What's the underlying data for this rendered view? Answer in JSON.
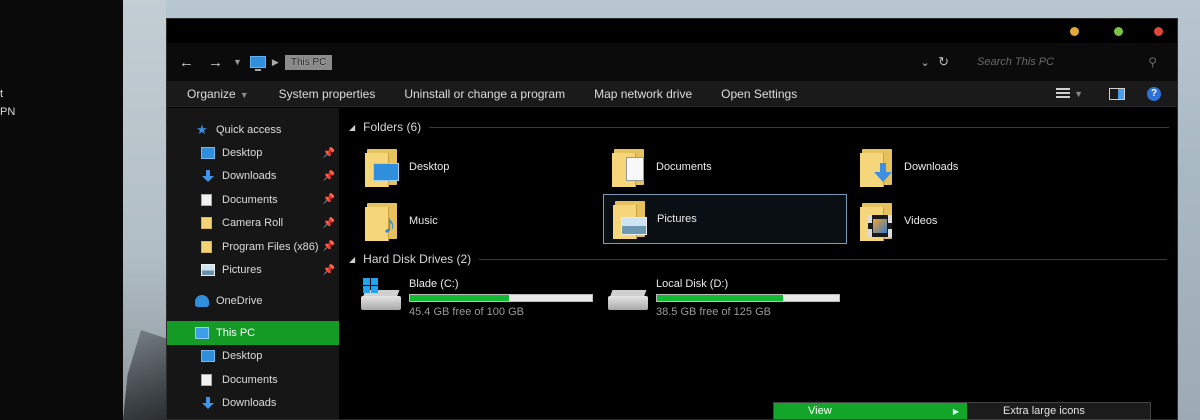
{
  "left_panel": {
    "line1": "t",
    "line2": "PN"
  },
  "address_bar": {
    "back_icon": "back-arrow-icon",
    "forward_icon": "forward-arrow-icon",
    "crumb": "This PC",
    "search_placeholder": "Search This PC"
  },
  "toolbar": {
    "items": [
      "Organize",
      "System properties",
      "Uninstall or change a program",
      "Map network drive",
      "Open Settings"
    ]
  },
  "nav": {
    "quick_access": "Quick access",
    "items": [
      {
        "label": "Desktop",
        "pinned": true
      },
      {
        "label": "Downloads",
        "pinned": true
      },
      {
        "label": "Documents",
        "pinned": true
      },
      {
        "label": "Camera Roll",
        "pinned": true
      },
      {
        "label": "Program Files (x86)",
        "pinned": true
      },
      {
        "label": "Pictures",
        "pinned": true
      }
    ],
    "onedrive": "OneDrive",
    "this_pc": "This PC",
    "this_pc_items": [
      "Desktop",
      "Documents",
      "Downloads"
    ]
  },
  "main": {
    "folders_header": "Folders (6)",
    "folders": [
      "Desktop",
      "Documents",
      "Downloads",
      "Music",
      "Pictures",
      "Videos"
    ],
    "selected_folder": "Pictures",
    "drives_header": "Hard Disk Drives (2)",
    "drives": [
      {
        "name": "Blade (C:)",
        "free": "45.4 GB free of 100 GB",
        "used_fraction": 0.546
      },
      {
        "name": "Local Disk (D:)",
        "free": "38.5 GB free of 125 GB",
        "used_fraction": 0.692
      }
    ]
  },
  "context_menu": {
    "view": "View",
    "submenu_first": "Extra large icons"
  },
  "colors": {
    "accent_green": "#139b26",
    "usage_bar": "#14b832",
    "link_blue": "#2f8fdc"
  }
}
